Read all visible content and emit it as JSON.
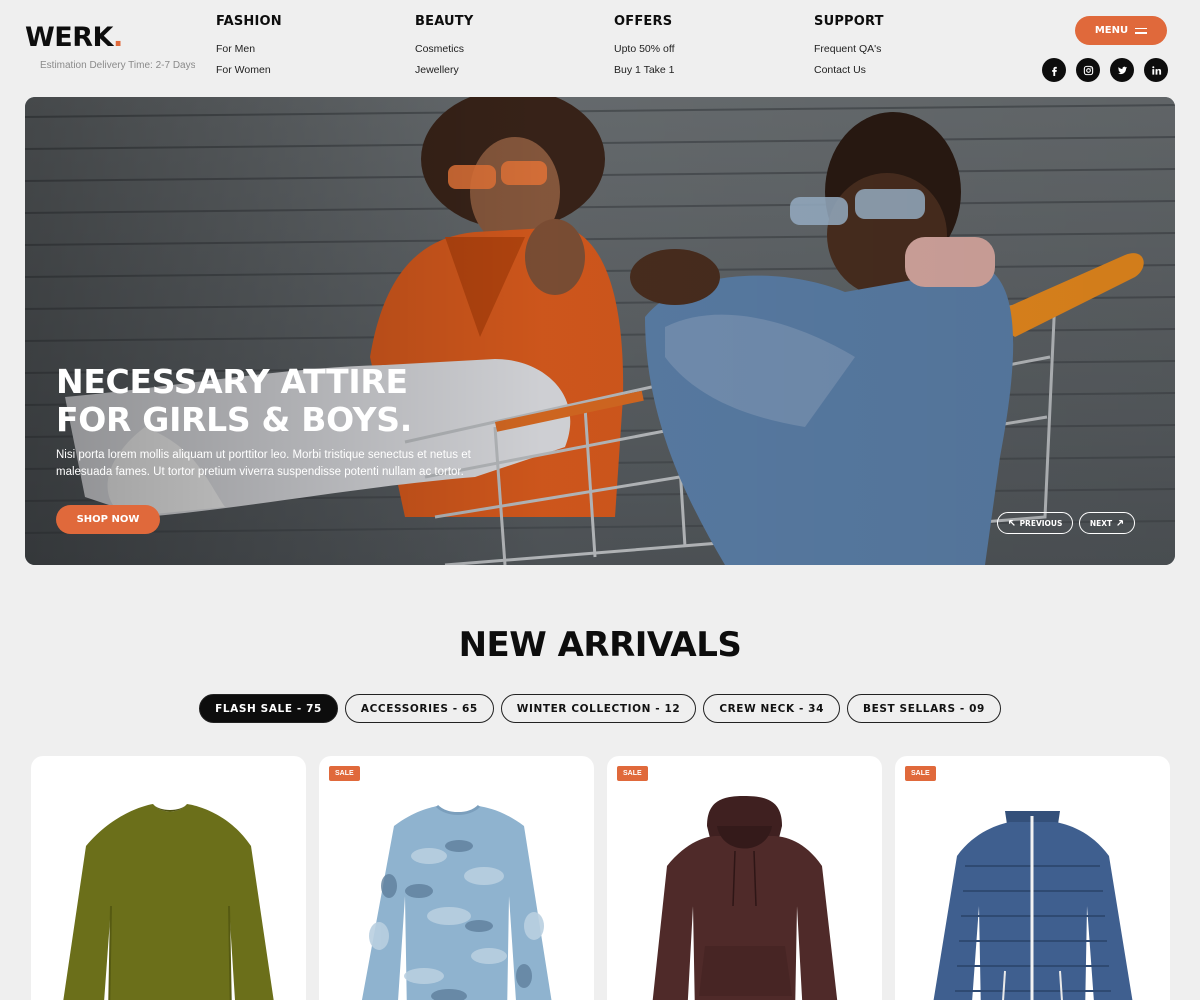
{
  "header": {
    "logo_text": "WERK",
    "logo_dot": ".",
    "delivery_text": "Estimation Delivery Time: 2-7 Days",
    "nav": [
      {
        "heading": "FASHION",
        "links": [
          "For Men",
          "For Women"
        ]
      },
      {
        "heading": "BEAUTY",
        "links": [
          "Cosmetics",
          "Jewellery"
        ]
      },
      {
        "heading": "OFFERS",
        "links": [
          "Upto 50% off",
          "Buy 1 Take 1"
        ]
      },
      {
        "heading": "SUPPORT",
        "links": [
          "Frequent QA's",
          "Contact Us"
        ]
      }
    ],
    "menu_label": "MENU",
    "socials": [
      "facebook-icon",
      "instagram-icon",
      "twitter-icon",
      "linkedin-icon"
    ]
  },
  "hero": {
    "title_line1": "NECESSARY ATTIRE",
    "title_line2": "FOR GIRLS & BOYS.",
    "description": "Nisi porta lorem mollis aliquam ut porttitor leo. Morbi tristique senectus et netus et malesuada fames. Ut tortor pretium viverra suspendisse potenti nullam ac tortor.",
    "cta_label": "SHOP NOW",
    "prev_label": "PREVIOUS",
    "next_label": "NEXT"
  },
  "arrivals": {
    "title": "NEW ARRIVALS",
    "tabs": [
      {
        "label": "FLASH SALE - 75",
        "active": true
      },
      {
        "label": "ACCESSORIES - 65",
        "active": false
      },
      {
        "label": "WINTER COLLECTION - 12",
        "active": false
      },
      {
        "label": "CREW NECK - 34",
        "active": false
      },
      {
        "label": "BEST SELLARS - 09",
        "active": false
      }
    ],
    "products": [
      {
        "badge": "",
        "garment": "olive long-sleeve sweater",
        "color": "#6b6f1a"
      },
      {
        "badge": "SALE",
        "garment": "camo long-sleeve tee",
        "color": "#8fb3cf"
      },
      {
        "badge": "SALE",
        "garment": "brown hoodie",
        "color": "#4f2a29"
      },
      {
        "badge": "SALE",
        "garment": "blue puffer jacket",
        "color": "#3f5f8f"
      }
    ]
  },
  "colors": {
    "accent": "#e0693b",
    "dark": "#0d0d0d",
    "background": "#efefef"
  }
}
